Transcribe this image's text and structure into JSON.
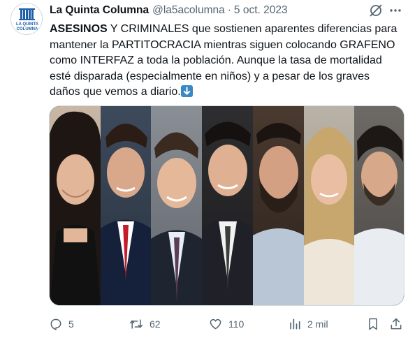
{
  "tweet": {
    "display_name": "La Quinta Columna",
    "handle": "@la5acolumna",
    "separator": "·",
    "date": "5 oct. 2023",
    "text_bold": "ASESINOS",
    "text_rest": " Y CRIMINALES que sostienen aparentes diferencias para mantener la PARTITOCRACIA mientras siguen colocando GRAFENO como INTERFAZ a toda la población. Aunque la tasa de mortalidad esté disparada (especialmente en niños) y a pesar de los graves daños que vemos a diario.",
    "emoji": "down-arrow-emoji",
    "avatar": {
      "logo_line1": "LA QUINTA",
      "logo_line2": "COLUMNA",
      "brand_color": "#1d5fa8"
    }
  },
  "media": {
    "description_icon": "photo-of-seven-politicians",
    "panels": 7
  },
  "actions": {
    "reply_count": "5",
    "retweet_count": "62",
    "like_count": "110",
    "views_count": "2 mil"
  },
  "icons": {
    "reply": "reply-icon",
    "retweet": "retweet-icon",
    "like": "heart-icon",
    "views": "views-icon",
    "bookmark": "bookmark-icon",
    "share": "share-icon",
    "grok": "grok-icon",
    "more": "more-icon"
  },
  "colors": {
    "text": "#0f1419",
    "secondary": "#536471",
    "border": "#cfd9de"
  }
}
